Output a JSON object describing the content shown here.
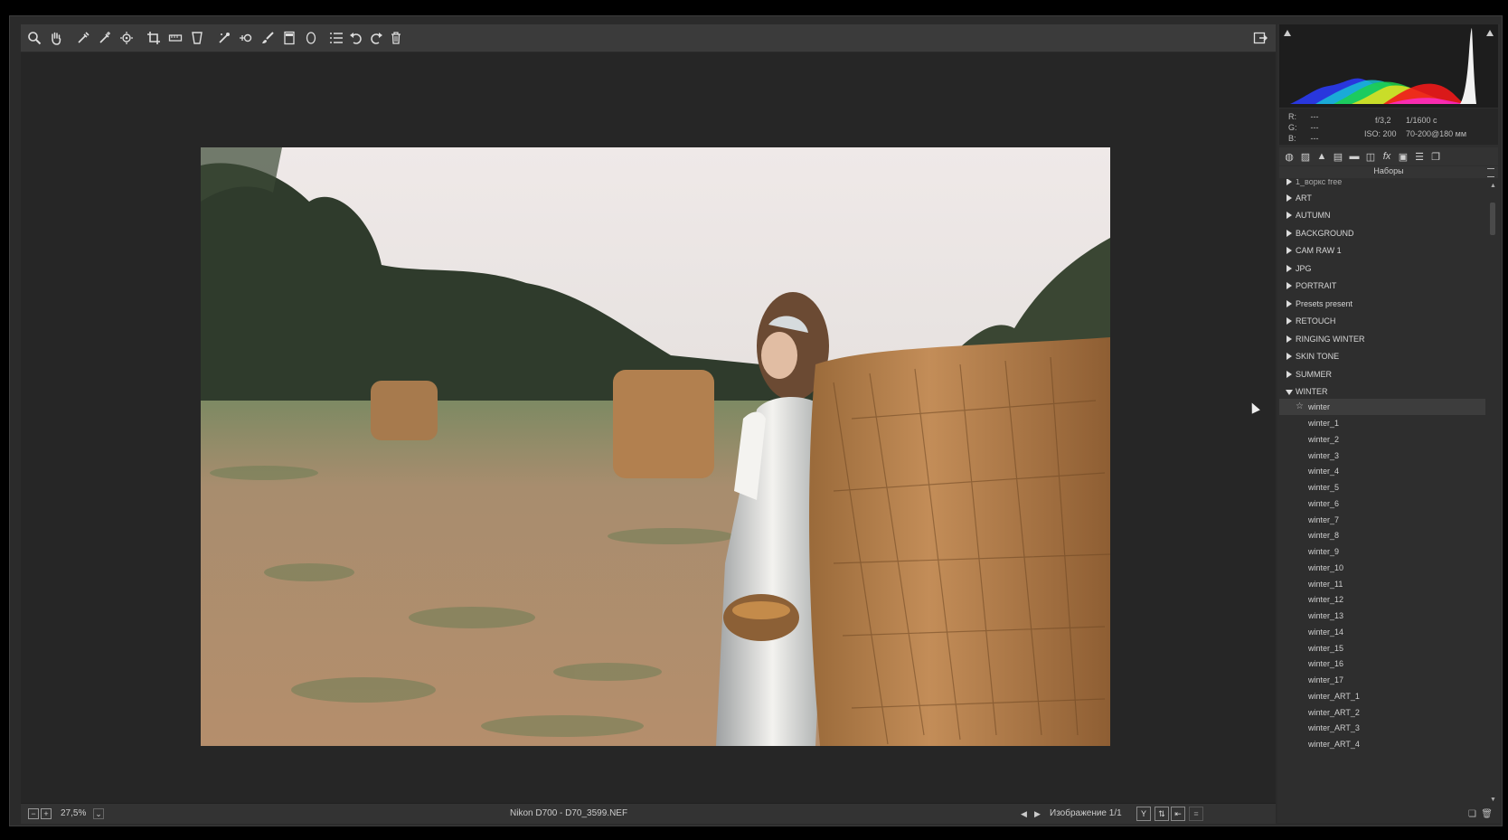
{
  "toolbar": {
    "tools": [
      "zoom-icon",
      "hand-icon",
      "white-balance-icon",
      "color-sampler-icon",
      "targeted-adjustment-icon",
      "crop-icon",
      "straighten-icon",
      "transform-icon",
      "spot-removal-icon",
      "red-eye-icon",
      "adjustment-brush-icon",
      "graduated-filter-icon",
      "radial-filter-icon",
      "preferences-icon",
      "rotate-left-icon",
      "rotate-right-icon",
      "trash-icon"
    ],
    "open_object_icon": "open-object-icon"
  },
  "status": {
    "zoom": "27,5%",
    "file_info": "Nikon D700  -  D70_3599.NEF",
    "image_counter": "Изображение 1/1"
  },
  "readout": {
    "r_label": "R:",
    "g_label": "G:",
    "b_label": "B:",
    "r_value": "---",
    "g_value": "---",
    "b_value": "---",
    "aperture": "f/3,2",
    "shutter": "1/1600 с",
    "iso": "ISO: 200",
    "lens": "70-200@180 мм"
  },
  "panel": {
    "title": "Наборы"
  },
  "presets": {
    "top_cut": "1_воркс free",
    "groups": [
      "ART",
      "AUTUMN",
      "BACKGROUND",
      "CAM RAW 1",
      "JPG",
      "PORTRAIT",
      "Presets present",
      "RETOUCH",
      "RINGING WINTER",
      "SKIN TONE",
      "SUMMER",
      "WINTER"
    ],
    "winter_items": [
      "winter",
      "winter_1",
      "winter_2",
      "winter_3",
      "winter_4",
      "winter_5",
      "winter_6",
      "winter_7",
      "winter_8",
      "winter_9",
      "winter_10",
      "winter_11",
      "winter_12",
      "winter_13",
      "winter_14",
      "winter_15",
      "winter_16",
      "winter_17",
      "winter_ART_1",
      "winter_ART_2",
      "winter_ART_3",
      "winter_ART_4"
    ]
  }
}
